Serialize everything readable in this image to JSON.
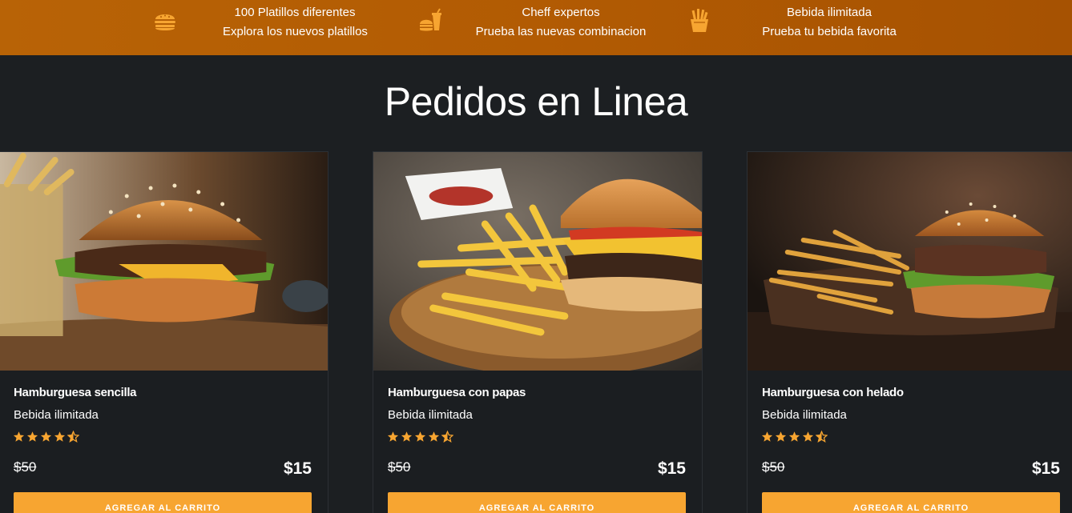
{
  "features": [
    {
      "icon": "hamburger-icon",
      "title": "100 Platillos diferentes",
      "subtitle": "Explora los nuevos platillos"
    },
    {
      "icon": "burger-drink-icon",
      "title": "Cheff expertos",
      "subtitle": "Prueba las nuevas combinacion"
    },
    {
      "icon": "fries-icon",
      "title": "Bebida ilimitada",
      "subtitle": "Prueba tu bebida favorita"
    }
  ],
  "section": {
    "title": "Pedidos en Linea"
  },
  "colors": {
    "accent": "#f7a531",
    "topbar": "#b25b03",
    "background": "#1c1f22"
  },
  "products": [
    {
      "name": "Hamburguesa sencilla",
      "desc": "Bebida ilimitada",
      "rating": 4.5,
      "old_price": "$50",
      "price": "$15",
      "button": "AGREGAR AL CARRITO"
    },
    {
      "name": "Hamburguesa con papas",
      "desc": "Bebida ilimitada",
      "rating": 4.5,
      "old_price": "$50",
      "price": "$15",
      "button": "AGREGAR AL CARRITO"
    },
    {
      "name": "Hamburguesa con helado",
      "desc": "Bebida ilimitada",
      "rating": 4.5,
      "old_price": "$50",
      "price": "$15",
      "button": "AGREGAR AL CARRITO"
    }
  ]
}
